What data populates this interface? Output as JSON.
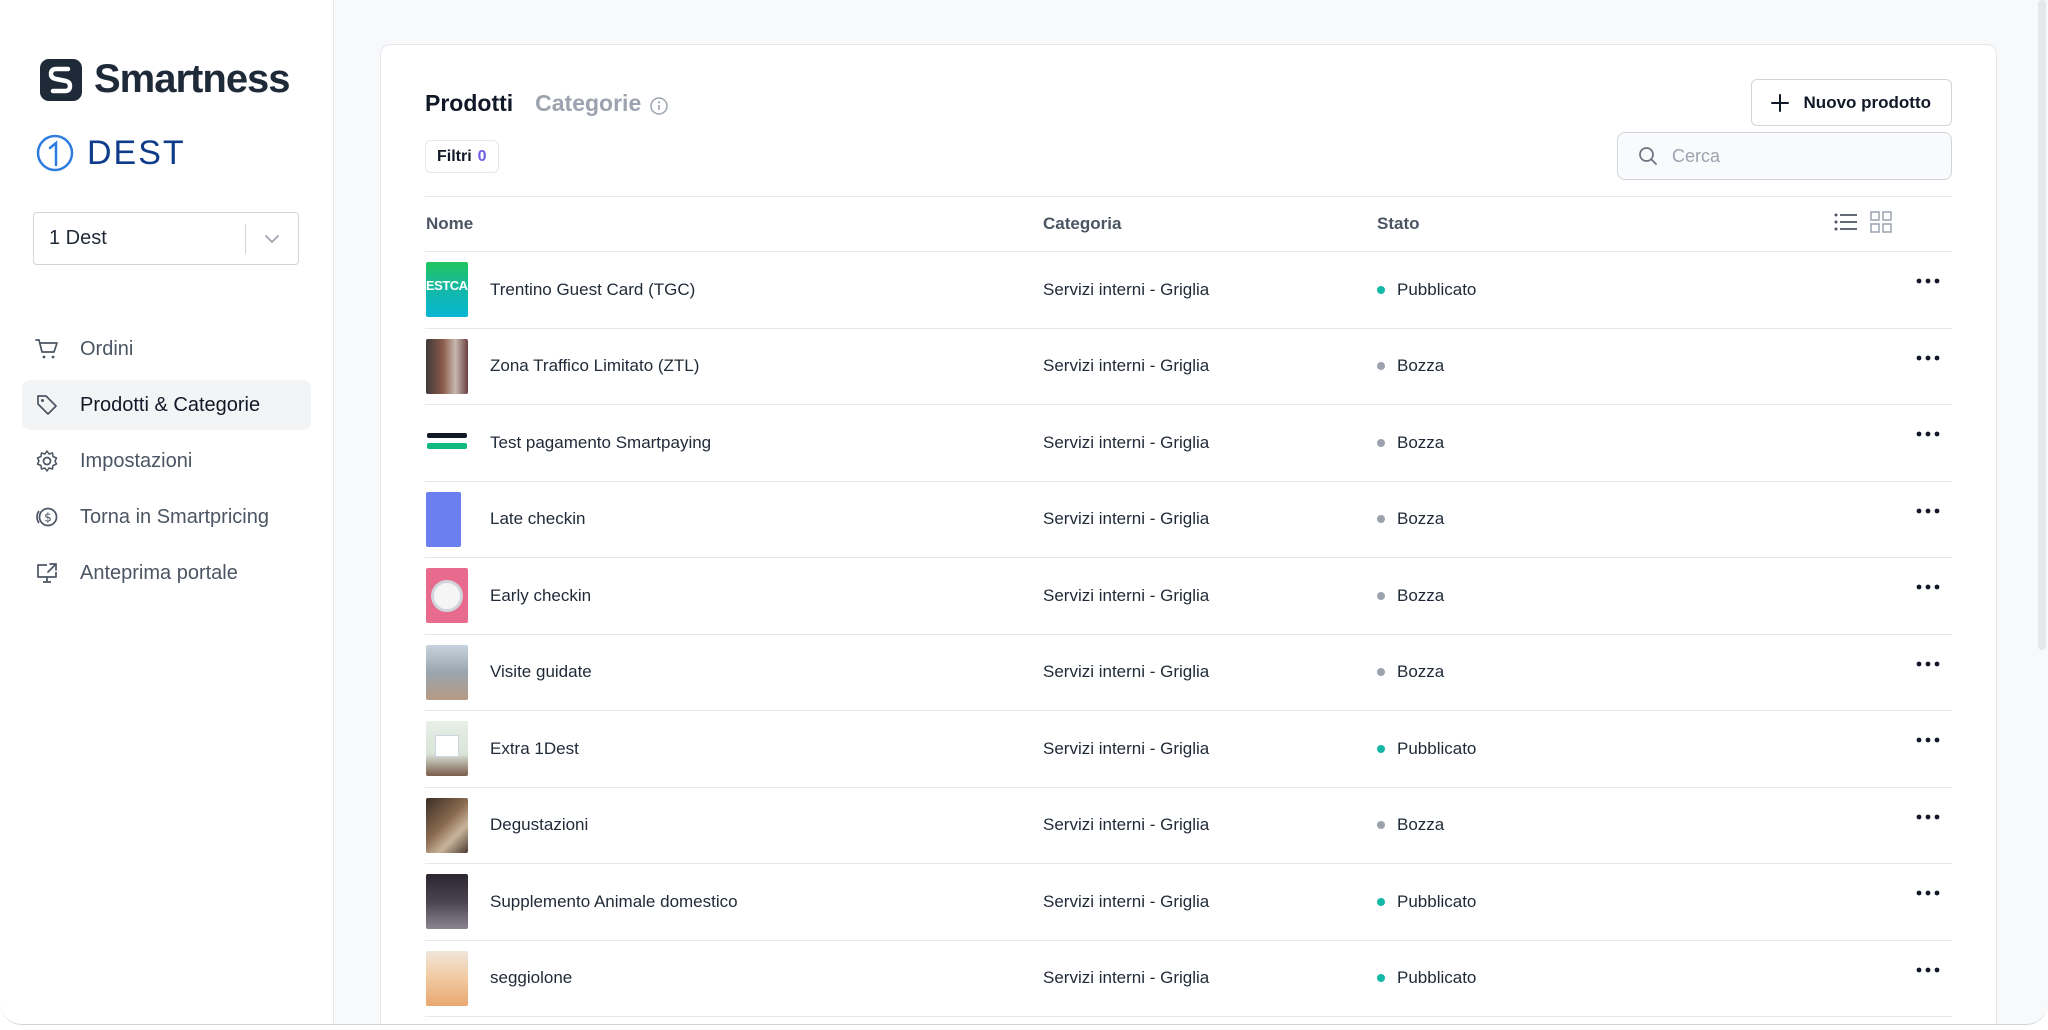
{
  "sidebar": {
    "brand": "Smartness",
    "property_logo": "DEST",
    "property_select": "1 Dest",
    "nav": [
      {
        "label": "Ordini",
        "icon": "cart-icon"
      },
      {
        "label": "Prodotti & Categorie",
        "icon": "tag-icon",
        "active": true
      },
      {
        "label": "Impostazioni",
        "icon": "gear-icon"
      },
      {
        "label": "Torna in Smartpricing",
        "icon": "dollar-coin-icon"
      },
      {
        "label": "Anteprima portale",
        "icon": "monitor-share-icon"
      }
    ]
  },
  "main": {
    "tabs": [
      "Prodotti",
      "Categorie"
    ],
    "new_button": "Nuovo prodotto",
    "filter_label": "Filtri",
    "filter_count": "0",
    "search_placeholder": "Cerca",
    "columns": [
      "Nome",
      "Categoria",
      "Stato"
    ],
    "rows": [
      {
        "name": "Trentino Guest Card (TGC)",
        "category": "Servizi interni - Griglia",
        "status": "Pubblicato",
        "published": true
      },
      {
        "name": "Zona Traffico Limitato (ZTL)",
        "category": "Servizi interni - Griglia",
        "status": "Bozza",
        "published": false
      },
      {
        "name": "Test pagamento Smartpaying",
        "category": "Servizi interni - Griglia",
        "status": "Bozza",
        "published": false
      },
      {
        "name": "Late checkin",
        "category": "Servizi interni - Griglia",
        "status": "Bozza",
        "published": false
      },
      {
        "name": "Early checkin",
        "category": "Servizi interni - Griglia",
        "status": "Bozza",
        "published": false
      },
      {
        "name": "Visite guidate",
        "category": "Servizi interni - Griglia",
        "status": "Bozza",
        "published": false
      },
      {
        "name": "Extra 1Dest",
        "category": "Servizi interni - Griglia",
        "status": "Pubblicato",
        "published": true
      },
      {
        "name": "Degustazioni",
        "category": "Servizi interni - Griglia",
        "status": "Bozza",
        "published": false
      },
      {
        "name": "Supplemento Animale domestico",
        "category": "Servizi interni - Griglia",
        "status": "Pubblicato",
        "published": true
      },
      {
        "name": "seggiolone",
        "category": "Servizi interni - Griglia",
        "status": "Pubblicato",
        "published": true
      }
    ]
  },
  "colors": {
    "published": "#14b8a6",
    "draft": "#9ca3af",
    "filter_count": "#6d5ce8",
    "brand_dark": "#1e2a38",
    "dest_blue": "#0f3c8a"
  }
}
